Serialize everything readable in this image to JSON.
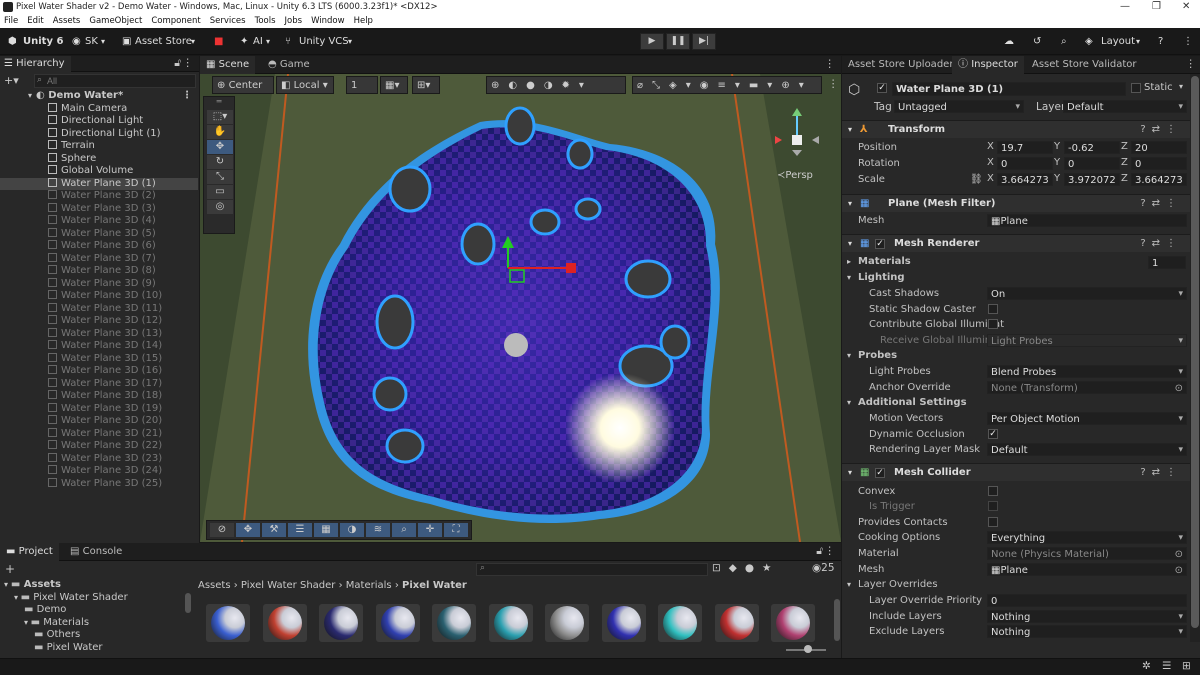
{
  "window": {
    "title": "Pixel Water Shader v2 - Demo Water - Windows, Mac, Linux - Unity 6.3 LTS (6000.3.23f1)* <DX12>"
  },
  "menu": [
    "File",
    "Edit",
    "Assets",
    "GameObject",
    "Component",
    "Services",
    "Tools",
    "Jobs",
    "Window",
    "Help"
  ],
  "toolbar": {
    "unity": "Unity 6",
    "account": "SK",
    "asset_store": "Asset Store",
    "ai": "AI",
    "vcs": "Unity VCS",
    "layout": "Layout"
  },
  "hierarchy": {
    "tab": "Hierarchy",
    "search_placeholder": "All",
    "scene": "Demo Water*",
    "items": [
      {
        "label": "Main Camera",
        "state": "on"
      },
      {
        "label": "Directional Light",
        "state": "on"
      },
      {
        "label": "Directional Light (1)",
        "state": "on"
      },
      {
        "label": "Terrain",
        "state": "on"
      },
      {
        "label": "Sphere",
        "state": "on"
      },
      {
        "label": "Global Volume",
        "state": "on"
      },
      {
        "label": "Water Plane 3D (1)",
        "state": "sel"
      },
      {
        "label": "Water Plane 3D (2)",
        "state": "dis"
      },
      {
        "label": "Water Plane 3D (3)",
        "state": "dis"
      },
      {
        "label": "Water Plane 3D (4)",
        "state": "dis"
      },
      {
        "label": "Water Plane 3D (5)",
        "state": "dis"
      },
      {
        "label": "Water Plane 3D (6)",
        "state": "dis"
      },
      {
        "label": "Water Plane 3D (7)",
        "state": "dis"
      },
      {
        "label": "Water Plane 3D (8)",
        "state": "dis"
      },
      {
        "label": "Water Plane 3D (9)",
        "state": "dis"
      },
      {
        "label": "Water Plane 3D (10)",
        "state": "dis"
      },
      {
        "label": "Water Plane 3D (11)",
        "state": "dis"
      },
      {
        "label": "Water Plane 3D (12)",
        "state": "dis"
      },
      {
        "label": "Water Plane 3D (13)",
        "state": "dis"
      },
      {
        "label": "Water Plane 3D (14)",
        "state": "dis"
      },
      {
        "label": "Water Plane 3D (15)",
        "state": "dis"
      },
      {
        "label": "Water Plane 3D (16)",
        "state": "dis"
      },
      {
        "label": "Water Plane 3D (17)",
        "state": "dis"
      },
      {
        "label": "Water Plane 3D (18)",
        "state": "dis"
      },
      {
        "label": "Water Plane 3D (19)",
        "state": "dis"
      },
      {
        "label": "Water Plane 3D (20)",
        "state": "dis"
      },
      {
        "label": "Water Plane 3D (21)",
        "state": "dis"
      },
      {
        "label": "Water Plane 3D (22)",
        "state": "dis"
      },
      {
        "label": "Water Plane 3D (23)",
        "state": "dis"
      },
      {
        "label": "Water Plane 3D (24)",
        "state": "dis"
      },
      {
        "label": "Water Plane 3D (25)",
        "state": "dis"
      }
    ]
  },
  "scene_view": {
    "tabs": [
      "Scene",
      "Game"
    ],
    "pivot": "Center",
    "space": "Local",
    "snap": "1",
    "persp": "Persp"
  },
  "project": {
    "tabs": [
      "Project",
      "Console"
    ],
    "tree": [
      {
        "label": "Assets",
        "depth": 0,
        "bold": true
      },
      {
        "label": "Pixel Water Shader",
        "depth": 1
      },
      {
        "label": "Demo",
        "depth": 2
      },
      {
        "label": "Materials",
        "depth": 2
      },
      {
        "label": "Others",
        "depth": 3
      },
      {
        "label": "Pixel Water",
        "depth": 3
      }
    ],
    "breadcrumb": [
      "Assets",
      "Pixel Water Shader",
      "Materials",
      "Pixel Water"
    ],
    "count": "25",
    "swatch_colors": [
      "#3a5fd0",
      "#c04030",
      "#2a2a70",
      "#3040b0",
      "#2a6070",
      "#2aa0b0",
      "#909090",
      "#3030b0",
      "#30c0c0",
      "#c03030",
      "#b04070"
    ]
  },
  "inspector": {
    "tabs": [
      "Asset Store Uploader",
      "Inspector",
      "Asset Store Validator"
    ],
    "object_name": "Water Plane 3D (1)",
    "static_label": "Static",
    "tag_label": "Tag",
    "tag": "Untagged",
    "layer_label": "Layer",
    "layer": "Default",
    "transform": {
      "title": "Transform",
      "position_label": "Position",
      "rotation_label": "Rotation",
      "scale_label": "Scale",
      "position": [
        "19.7",
        "-0.62",
        "20"
      ],
      "rotation": [
        "0",
        "0",
        "0"
      ],
      "scale": [
        "3.664273",
        "3.972072",
        "3.664273"
      ]
    },
    "axes": [
      "X",
      "Y",
      "Z"
    ],
    "mesh_filter": {
      "title": "Plane (Mesh Filter)",
      "mesh_label": "Mesh",
      "mesh": "Plane"
    },
    "mesh_renderer": {
      "title": "Mesh Renderer",
      "materials_label": "Materials",
      "materials_count": "1",
      "lighting": "Lighting",
      "cast_shadows_label": "Cast Shadows",
      "cast_shadows": "On",
      "static_shadow_label": "Static Shadow Caster",
      "contribute_gi_label": "Contribute Global Illuminat",
      "receive_gi_label": "Receive Global Illuminati",
      "receive_gi": "Light Probes",
      "probes": "Probes",
      "light_probes_label": "Light Probes",
      "light_probes": "Blend Probes",
      "anchor_label": "Anchor Override",
      "anchor": "None (Transform)",
      "additional": "Additional Settings",
      "motion_label": "Motion Vectors",
      "motion": "Per Object Motion",
      "dyn_occ_label": "Dynamic Occlusion",
      "rlm_label": "Rendering Layer Mask",
      "rlm": "Default"
    },
    "mesh_collider": {
      "title": "Mesh Collider",
      "convex_label": "Convex",
      "trigger_label": "Is Trigger",
      "contacts_label": "Provides Contacts",
      "cooking_label": "Cooking Options",
      "cooking": "Everything",
      "material_label": "Material",
      "material": "None (Physics Material)",
      "mesh_label": "Mesh",
      "mesh": "Plane",
      "overrides": "Layer Overrides",
      "priority_label": "Layer Override Priority",
      "priority": "0",
      "include_label": "Include Layers",
      "include": "Nothing",
      "exclude_label": "Exclude Layers",
      "exclude": "Nothing"
    }
  }
}
